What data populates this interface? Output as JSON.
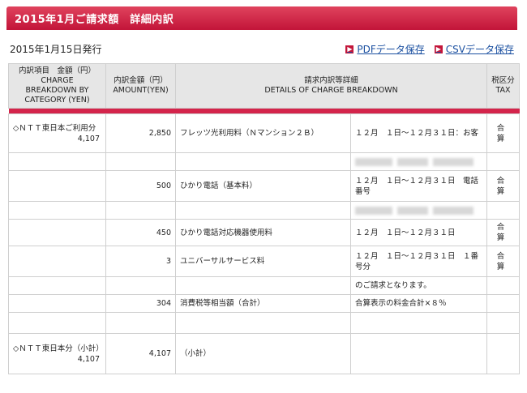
{
  "header": {
    "title": "2015年1月ご請求額　詳細内訳",
    "issue_date": "2015年1月15日発行"
  },
  "links": {
    "pdf": "PDFデータ保存",
    "csv": "CSVデータ保存",
    "arrow_icon": "arrow-right-icon"
  },
  "colors": {
    "accent": "#c3163a",
    "link": "#1a4fa0",
    "header_bg": "#e6e6e6"
  },
  "table": {
    "headers": {
      "category": [
        "内訳項目　金額（円）",
        "CHARGE",
        "BREAKDOWN BY",
        "CATEGORY (YEN)"
      ],
      "amount": [
        "内訳金額（円）",
        "AMOUNT(YEN)"
      ],
      "details": [
        "請求内訳等詳細",
        "DETAILS OF CHARGE BREAKDOWN"
      ],
      "tax": [
        "税区分",
        "TAX"
      ]
    },
    "rows": [
      {
        "category": "◇ＮＴＴ東日本ご利用分",
        "category_value": "4,107",
        "amount": "2,850",
        "item": "フレッツ光利用料（Ｎマンション２Ｂ）",
        "detail": "１２月　１日〜１２月３１日：お客",
        "tax": "合算"
      },
      {
        "category": "",
        "category_value": "",
        "amount": "",
        "item": "",
        "detail": "",
        "tax": "",
        "redacted": true
      },
      {
        "category": "",
        "category_value": "",
        "amount": "500",
        "item": "ひかり電話（基本料）",
        "detail": "１２月　１日〜１２月３１日　電話番号",
        "tax": "合算"
      },
      {
        "category": "",
        "category_value": "",
        "amount": "",
        "item": "",
        "detail": "",
        "tax": "",
        "redacted": true
      },
      {
        "category": "",
        "category_value": "",
        "amount": "450",
        "item": "ひかり電話対応機器使用料",
        "detail": "１２月　１日〜１２月３１日",
        "tax": "合算"
      },
      {
        "category": "",
        "category_value": "",
        "amount": "3",
        "item": "ユニバーサルサービス料",
        "detail": "１２月　１日〜１２月３１日　１番号分",
        "tax": "合算"
      },
      {
        "category": "",
        "category_value": "",
        "amount": "",
        "item": "",
        "detail": "のご請求となります。",
        "tax": ""
      },
      {
        "category": "",
        "category_value": "",
        "amount": "304",
        "item": "消費税等相当額（合計）",
        "detail": "合算表示の料金合計×８％",
        "tax": ""
      },
      {
        "category": "",
        "category_value": "",
        "amount": "",
        "item": "",
        "detail": "",
        "tax": ""
      },
      {
        "category": "◇ＮＴＴ東日本分（小計）",
        "category_value": "4,107",
        "amount": "4,107",
        "item": "（小計）",
        "detail": "",
        "tax": ""
      }
    ]
  }
}
